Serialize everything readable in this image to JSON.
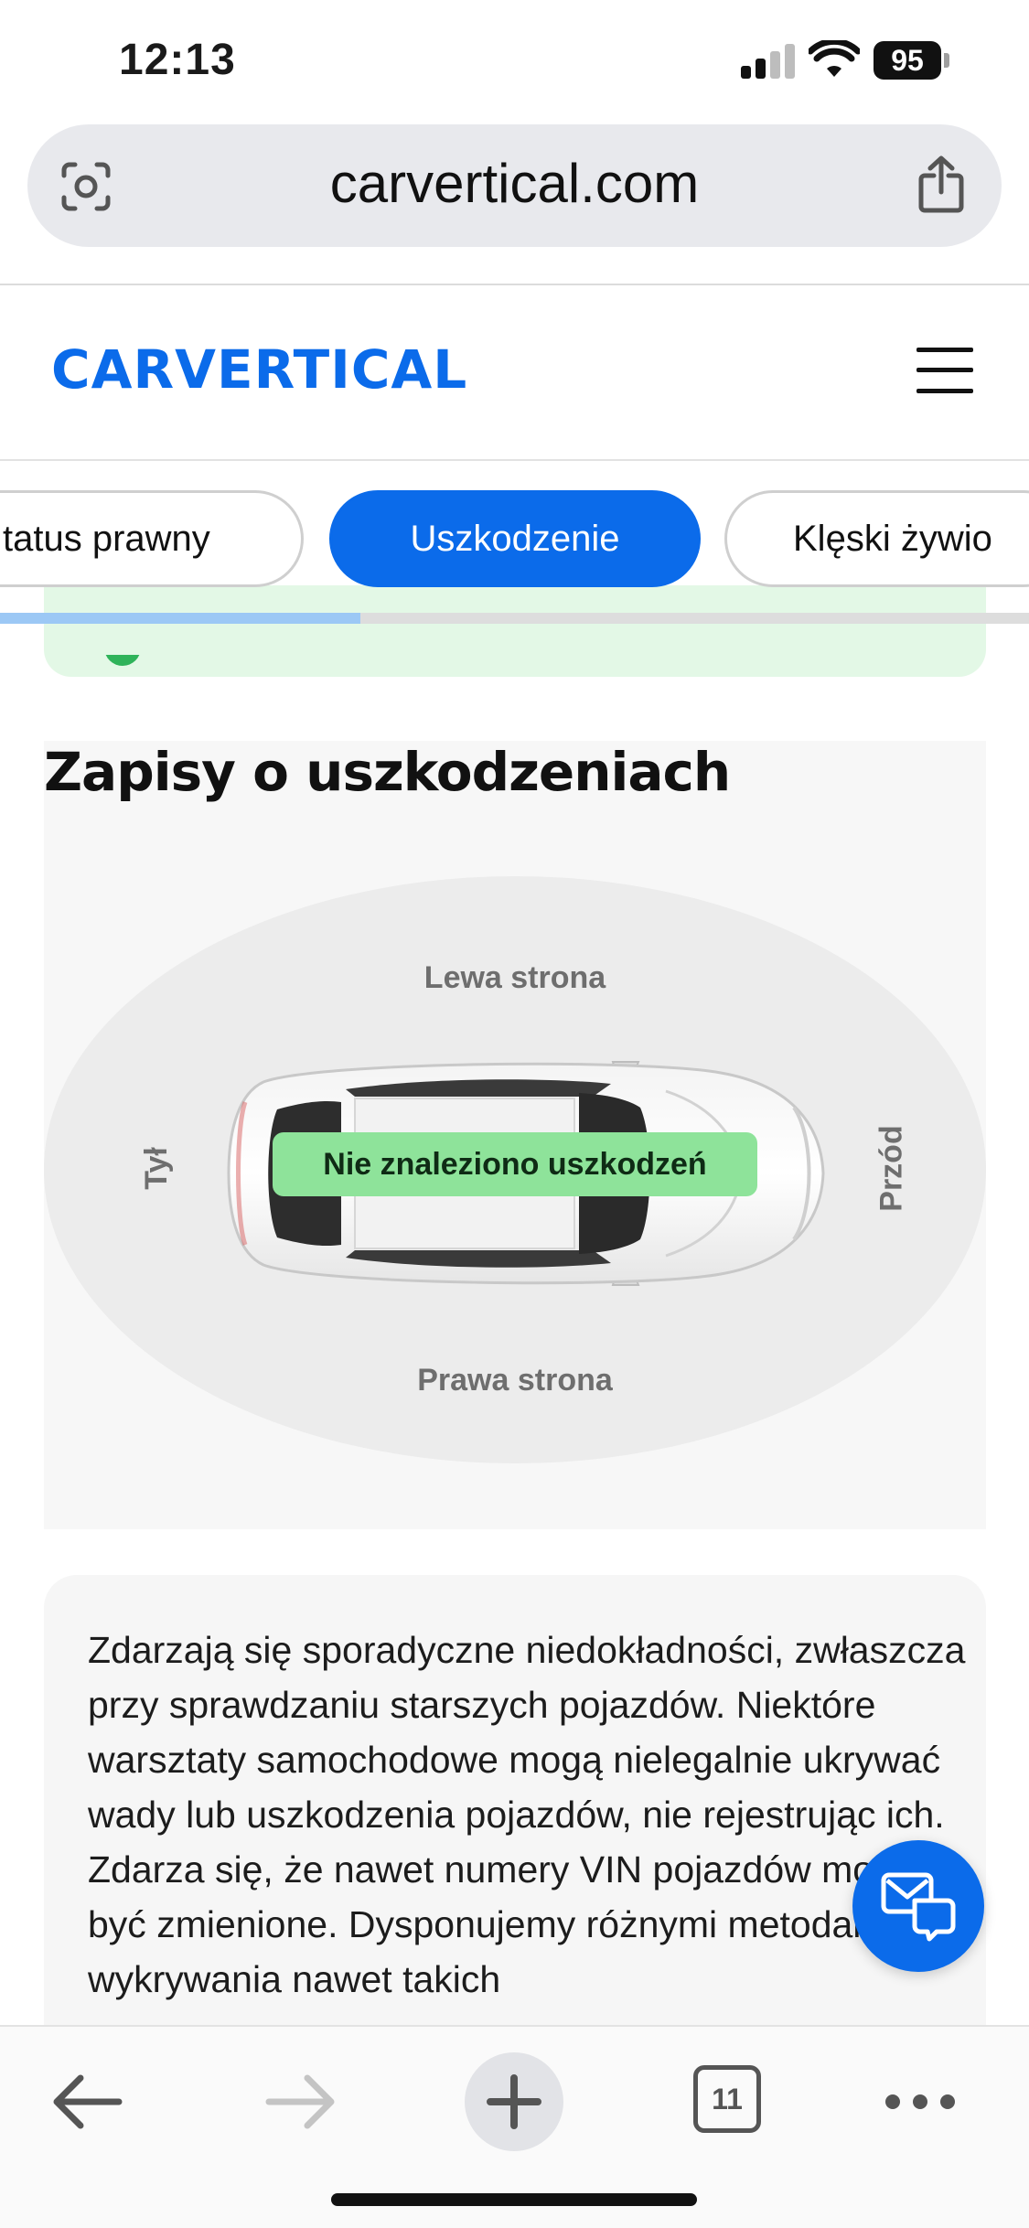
{
  "status_bar": {
    "time": "12:13",
    "battery": "95"
  },
  "browser": {
    "url": "carvertical.com",
    "open_tabs": "11"
  },
  "site": {
    "logo": "CARVERTICAL"
  },
  "tabs": [
    {
      "label": "Status prawny",
      "visible_label": "tatus prawny"
    },
    {
      "label": "Uszkodzenie",
      "active": true
    },
    {
      "label": "Klęski żywio",
      "visible_label": "Klęski żywio"
    }
  ],
  "tab_scroll_progress": 0.35,
  "damage": {
    "title": "Zapisy o uszkodzeniach",
    "left_side": "Lewa strona",
    "right_side": "Prawa strona",
    "rear": "Tył",
    "front": "Przód",
    "status": "Nie znaleziono uszkodzeń"
  },
  "info_text": "Zdarzają się sporadyczne niedokładności, zwłaszcza przy sprawdzaniu starszych pojazdów. Niektóre warsztaty samochodowe mogą nielegalnie ukrywać wady lub uszkodzenia pojazdów, nie rejestrując ich. Zdarza się, że nawet numery VIN pojazdów mogą być zmienione. Dysponujemy różnymi metodami wykrywania nawet takich",
  "colors": {
    "brand": "#0b6bea",
    "badge_green": "#8ee39a",
    "strip_green": "#e3f8e6"
  },
  "icons": {
    "lens": "lens-icon",
    "share": "share-icon",
    "menu": "hamburger-icon",
    "chat": "chat-icon",
    "back": "back-arrow-icon",
    "forward": "forward-arrow-icon",
    "new_tab": "plus-icon",
    "more": "ellipsis-icon"
  }
}
